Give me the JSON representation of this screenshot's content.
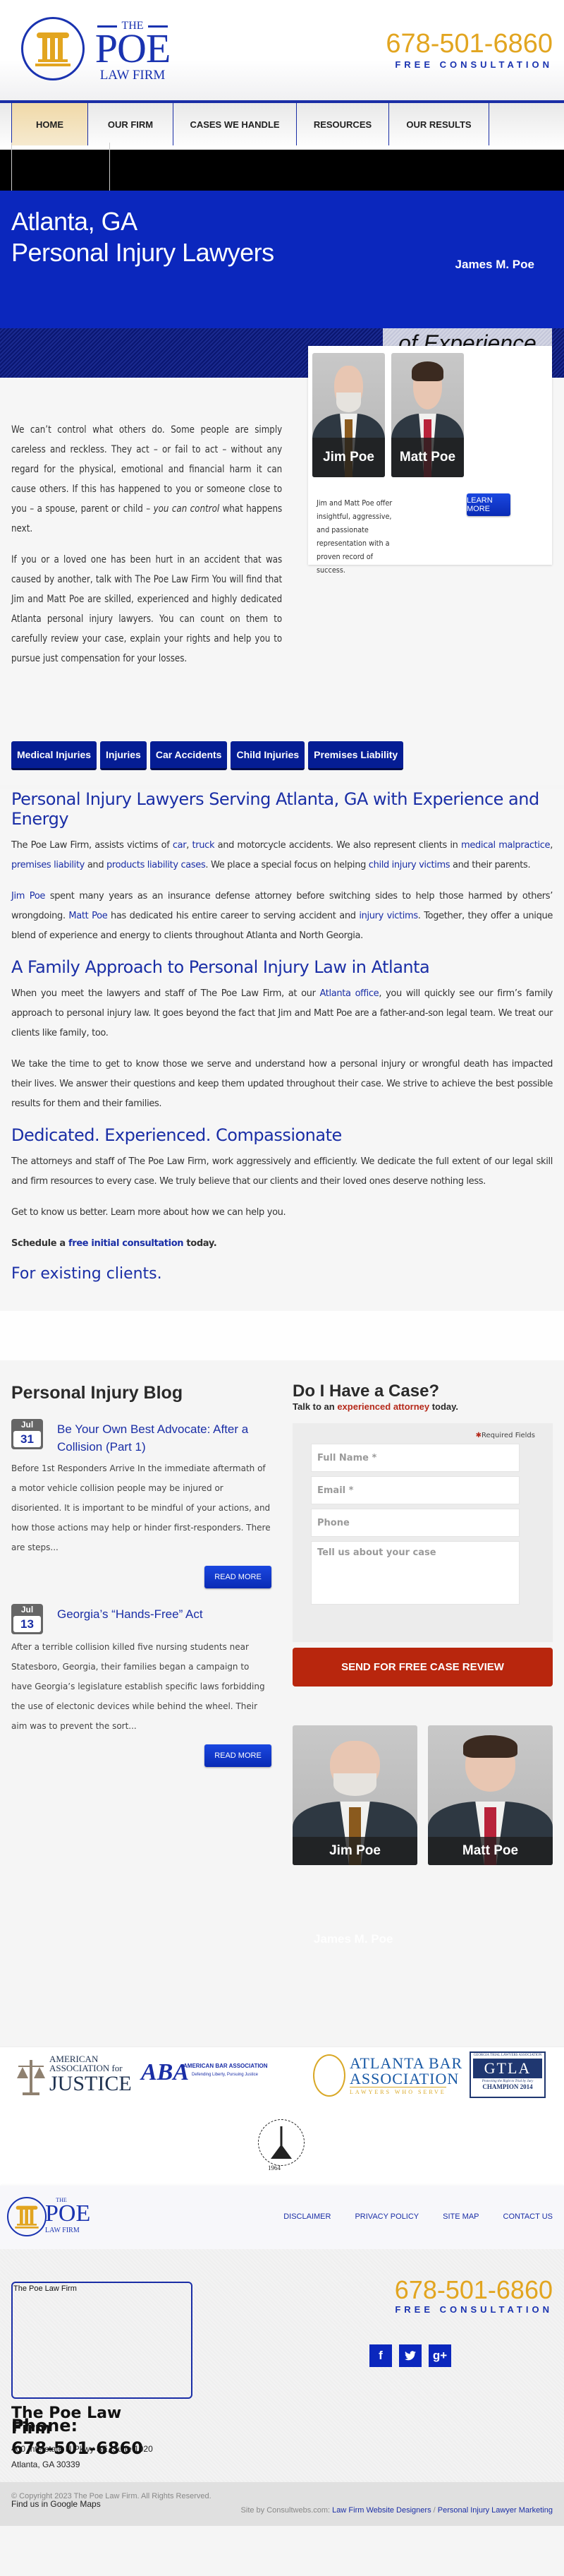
{
  "header": {
    "logo": {
      "the": "THE",
      "name": "POE",
      "sub": "LAW FIRM"
    },
    "phone": "678-501-6860",
    "phone_sub": "FREE CONSULTATION"
  },
  "nav": {
    "items": [
      {
        "label": "HOME",
        "active": true
      },
      {
        "label": "OUR FIRM"
      },
      {
        "label": "CASES WE HANDLE"
      },
      {
        "label": "RESOURCES"
      },
      {
        "label": "OUR RESULTS"
      }
    ]
  },
  "hero": {
    "title_line1": "Atlanta, GA",
    "title_line2": "Personal Injury Lawyers",
    "attorney_name": "James M. Poe",
    "experience_banner": "of Experience"
  },
  "intro": {
    "p1_start": "We can’t control what others do. Some people are simply careless and reckless. They act – or fail to act – without any regard for the physical, emotional and financial harm it can cause others. If this has happened to you or someone close to you – a spouse, parent or child – ",
    "p1_em": "you can control",
    "p1_end": " what happens next.",
    "p2": "If you or a loved one has been hurt in an accident that was caused by another, talk with The Poe Law Firm You will find that Jim and Matt Poe are skilled, experienced and highly dedicated Atlanta personal injury lawyers. You can count on them to carefully review your case, explain your rights and help you to pursue just compensation for your losses."
  },
  "attorney_card": {
    "attorneys": [
      {
        "name": "Jim Poe"
      },
      {
        "name": "Matt Poe"
      }
    ],
    "description": "Jim and Matt Poe offer insightful, aggressive, and passionate representation with a proven record of success.",
    "learn_more": "LEARN MORE"
  },
  "practice_areas": [
    "Medical Injuries",
    "Injuries",
    "Car Accidents",
    "Child Injuries",
    "Premises Liability"
  ],
  "main": {
    "h1": "Personal Injury Lawyers Serving Atlanta, GA with Experience and Energy",
    "p1": {
      "a": "The Poe Law Firm, assists victims of ",
      "car": "car",
      "b": ", ",
      "truck": "truck",
      "c": " and motorcycle accidents. We also represent clients in ",
      "medmal": "medical malpractice",
      "d": ", ",
      "premises": "premises liability",
      "e": " and ",
      "products": "products liability cases",
      "f": ". We place a special focus on helping ",
      "child": "child injury victims",
      "g": " and their parents."
    },
    "p2": {
      "jim": "Jim Poe",
      "a": " spent many years as an insurance defense attorney before switching sides to help those harmed by others’ wrongdoing. ",
      "matt": "Matt Poe",
      "b": " has dedicated his entire career to serving accident and ",
      "injury": "injury victims",
      "c": ". Together, they offer a unique blend of experience and energy to clients throughout Atlanta and North Georgia."
    },
    "h2": "A Family Approach to Personal Injury Law in Atlanta",
    "p3": {
      "a": "When you meet the lawyers and staff of The Poe Law Firm, at our ",
      "office": "Atlanta office",
      "b": ", you will quickly see our firm’s family approach to personal injury law. It goes beyond the fact that Jim and Matt Poe are a father-and-son legal team. We treat our clients like family, too."
    },
    "p4": "We take the time to get to know those we serve and understand how a personal injury or wrongful death has impacted their lives. We answer their questions and keep them updated throughout their case. We strive to achieve the best possible results for them and their families.",
    "h3": "Dedicated. Experienced. Compassionate",
    "p5": "The attorneys and staff of The Poe Law Firm, work aggressively and efficiently. We dedicate the full extent of our legal skill and firm resources to every case. We truly believe that our clients and their loved ones deserve nothing less.",
    "p6": "Get to know us better. Learn more about how we can help you.",
    "cta": {
      "a": "Schedule a ",
      "link": "free initial consultation",
      "b": " today."
    },
    "existing": "For existing clients."
  },
  "blog": {
    "title": "Personal Injury Blog",
    "posts": [
      {
        "month": "Jul",
        "day": "31",
        "title": "Be Your Own Best Advocate: After a Collision (Part 1)",
        "excerpt": "Before 1st Responders Arrive In the immediate aftermath of a motor vehicle collision people may be injured or disoriented.  It is important to be mindful of your actions, and how those actions may help or hinder first-responders.  There are steps...",
        "read_more": "READ MORE"
      },
      {
        "month": "Jul",
        "day": "13",
        "title": "Georgia’s “Hands-Free” Act",
        "excerpt": "After a terrible collision killed five nursing students near Statesboro, Georgia, their families began a campaign to have Georgia’s legislature establish specific laws forbidding the use of electonic devices while behind the wheel.   Their aim was to prevent the sort...",
        "read_more": "READ MORE"
      }
    ]
  },
  "case_form": {
    "title": "Do I Have a Case?",
    "tagline_a": "Talk to an ",
    "tagline_link": "experienced attorney",
    "tagline_b": " today.",
    "required_note": "Required Fields",
    "fields": {
      "name_placeholder": "Full Name *",
      "email_placeholder": "Email *",
      "phone_placeholder": "Phone",
      "message_placeholder": "Tell us about your case"
    },
    "submit": "SEND FOR FREE CASE REVIEW",
    "attorneys": [
      {
        "name": "Jim Poe"
      },
      {
        "name": "Matt Poe"
      }
    ],
    "ghost_name": "James M. Poe"
  },
  "affiliations": {
    "aaj": {
      "l1": "AMERICAN",
      "l2": "ASSOCIATION for",
      "l3": "JUSTICE"
    },
    "aba": {
      "mark": "ABA",
      "l1": "AMERICAN BAR ASSOCIATION",
      "l2": "Defending Liberty, Pursuing Justice"
    },
    "atlanta": {
      "l1": "ATLANTA BAR",
      "l2": "ASSOCIATION",
      "l3": "LAWYERS WHO SERVE"
    },
    "gtla": {
      "l0": "GEORGIA TRIAL LAWYERS ASSOCIATION",
      "l1": "GTLA",
      "l2": "Protecting the Right to Trial by Jury",
      "l3": "CHAMPION 2014"
    },
    "sbg": {
      "name": "STATE BAR OF GEORGIA",
      "year": "1964"
    }
  },
  "footer": {
    "links": [
      "DISCLAIMER",
      "PRIVACY POLICY",
      "SITE MAP",
      "CONTACT US"
    ],
    "map_label": "The Poe Law Firm",
    "firm_name": "The Poe Law Firm",
    "address1": "400 Interstate N Pkwy SE, Suite 1020",
    "address2": "Atlanta, GA 30339",
    "phone_label": "Phone:",
    "phone": "678-501-6860",
    "phone_sub": "FREE CONSULTATION",
    "social": [
      "f",
      "t",
      "g+"
    ],
    "copyright": "© Copyright 2023 The Poe Law Firm. All Rights Reserved.",
    "google_maps": "Find us in Google Maps",
    "site_by": "Site by Consultwebs.com: ",
    "site_link1": "Law Firm Website Designers",
    "site_sep": " / ",
    "site_link2": "Personal Injury Lawyer Marketing"
  },
  "colors": {
    "brand_blue": "#1a2ea6",
    "hero_blue": "#0b27bd",
    "gold": "#e2a520",
    "cta_red": "#b8260d"
  }
}
